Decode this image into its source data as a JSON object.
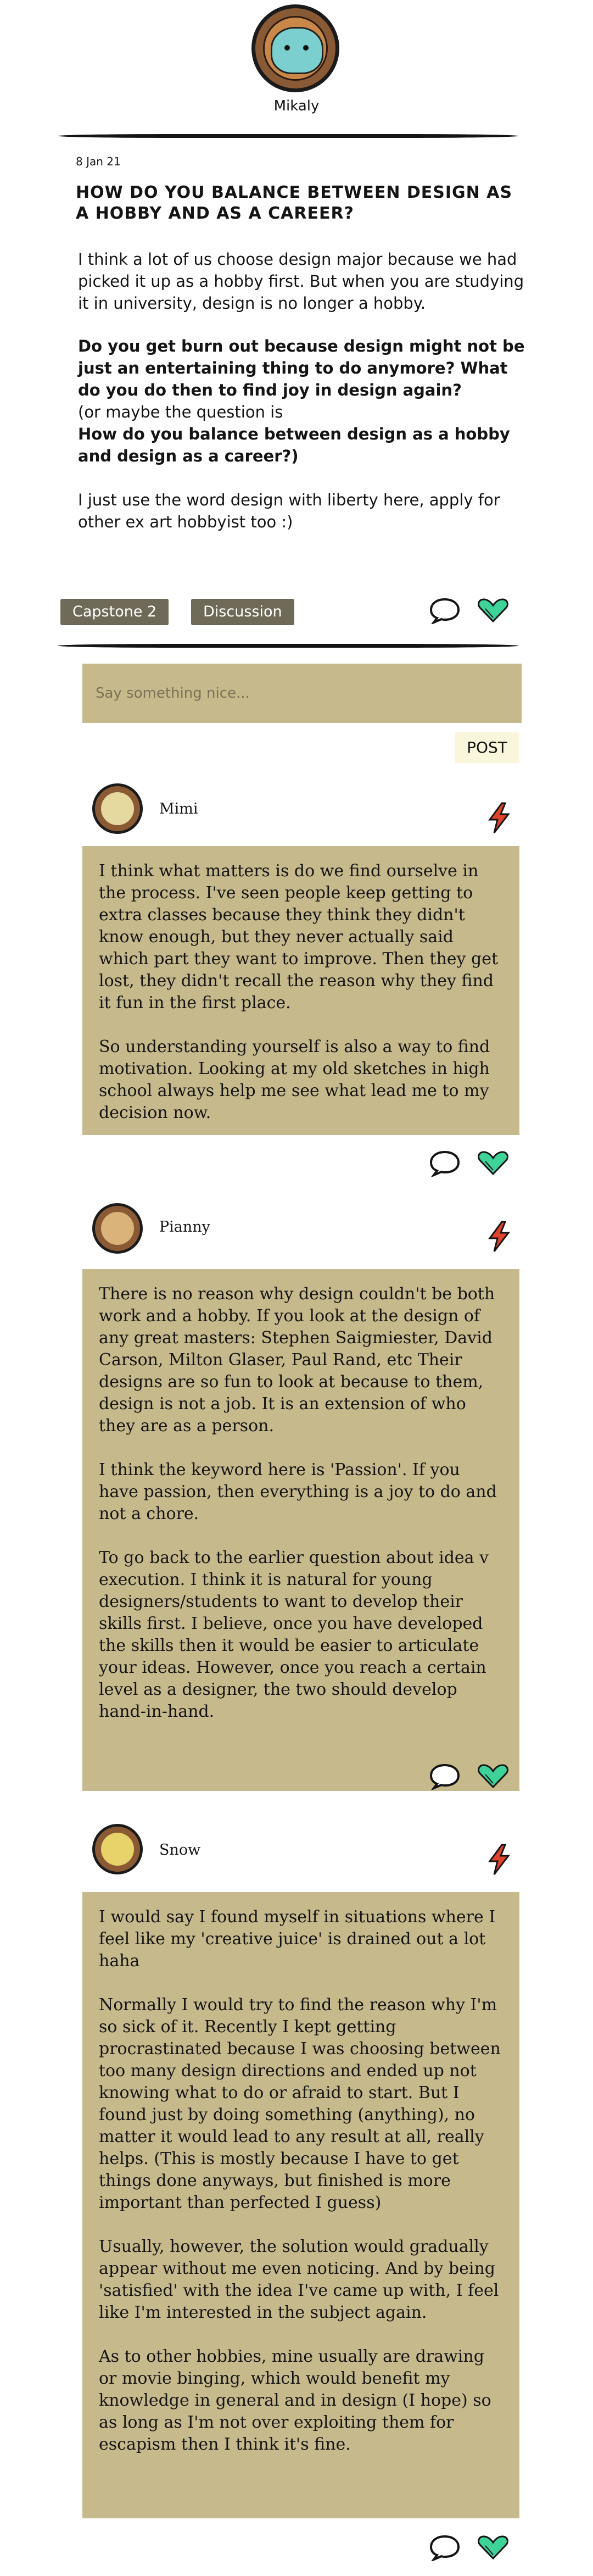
{
  "author": {
    "name": "Mikaly"
  },
  "post": {
    "date": "8 Jan 21",
    "title": "HOW DO YOU BALANCE BETWEEN DESIGN AS A HOBBY AND AS A CAREER?",
    "body": [
      "I think a lot of us choose design major because we had picked it up as a hobby first. But when you are studying it in university, design is no longer a hobby.",
      "Do you get burn out because design might not be just an entertaining thing to do anymore? What do you do then to find joy in design again?",
      "(or maybe the question is",
      "How do you balance between design as a hobby and design as a career?)",
      "I just use the word design with liberty here, apply for other ex art hobbyist too :)"
    ],
    "tags": [
      "Capstone 2",
      "Discussion"
    ]
  },
  "comment_form": {
    "placeholder": "Say something nice...",
    "post_label": "POST"
  },
  "comments": [
    {
      "name": "Mimi",
      "paragraphs": [
        "I think what matters is do we find ourselve in the process. I've seen people keep getting to extra classes because they think they didn't know enough, but they never actually said which part they want to improve. Then they get lost, they didn't recall the reason why they find it fun in the first place.",
        "So understanding yourself is also a way to find motivation. Looking at my old sketches in high school always help me see what lead me to my decision now."
      ]
    },
    {
      "name": "Pianny",
      "paragraphs": [
        "There is no reason why design couldn't be both work and a hobby. If you look at the design of any great masters: Stephen Saigmiester, David Carson, Milton Glaser, Paul Rand, etc Their designs are so fun to look at because to them, design is not a job. It is an extension of who they are as a person.",
        "I think the keyword here is 'Passion'. If you have passion, then everything is a joy to do and not a chore.",
        "To go back to the earlier question about idea v execution. I think it is natural for young designers/students to want to develop their skills first. I believe, once you have developed the skills then it would be easier to articulate your ideas. However, once you reach a certain level as a designer, the two should develop hand-in-hand."
      ]
    },
    {
      "name": "Snow",
      "paragraphs": [
        "I would say I found myself in situations where I feel like my 'creative juice' is drained out a lot haha",
        "Normally I would try to find the reason why I'm so sick of it. Recently I kept getting procrastinated because I was choosing between too many design directions and ended up not knowing what to do or afraid to start. But I found just by doing something (anything), no matter it would lead to any result at all, really helps. (This is mostly because I have to get things done anyways, but finished is more important than perfected I guess)",
        "Usually, however, the solution would gradually appear without me even noticing. And by being 'satisfied' with the idea I've came up with, I feel like I'm interested in the subject again.",
        "As to other hobbies, mine usually are drawing or movie binging, which would benefit my knowledge in general and in design (I hope) so as long as I'm not over exploiting them for escapism then I think it's fine."
      ]
    }
  ],
  "colors": {
    "card": "#c6b98c",
    "tag": "#6f6a58",
    "heart": "#3fd39a",
    "bolt": "#e0432b",
    "post_button": "#faf6dc"
  },
  "icons": [
    "chat-bubble-icon",
    "heart-icon",
    "lightning-bolt-icon"
  ]
}
